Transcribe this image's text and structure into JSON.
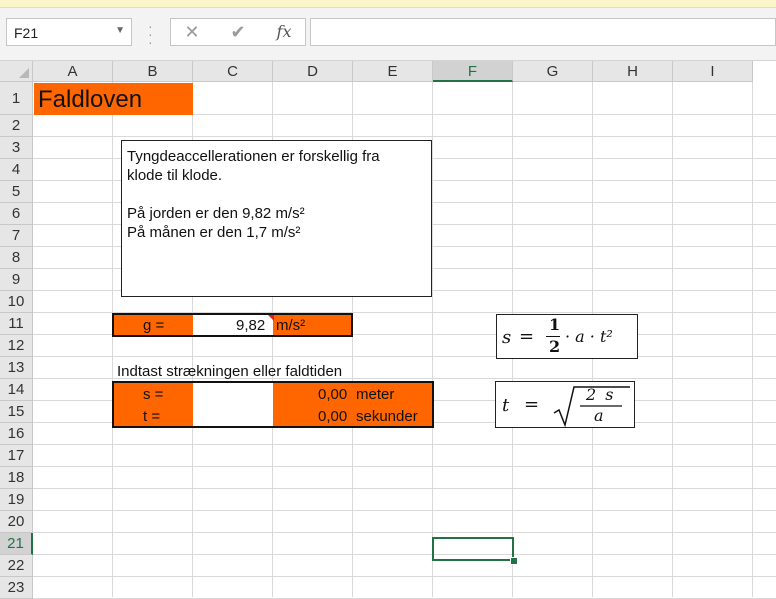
{
  "namebox": {
    "value": "F21"
  },
  "formula_bar": {
    "cancel_icon": "✕",
    "enter_icon": "✔",
    "fx_label": "fx",
    "value": ""
  },
  "columns": [
    "A",
    "B",
    "C",
    "D",
    "E",
    "F",
    "G",
    "H",
    "I"
  ],
  "selected_column": "F",
  "rows": [
    "1",
    "2",
    "3",
    "4",
    "5",
    "6",
    "7",
    "8",
    "9",
    "10",
    "11",
    "12",
    "13",
    "14",
    "15",
    "16",
    "17",
    "18",
    "19",
    "20",
    "21",
    "22",
    "23"
  ],
  "selected_row": "21",
  "sheet": {
    "title": "Faldloven",
    "textbox_lines": [
      "Tyngdeaccellerationen er forskellig fra",
      "klode til klode.",
      "",
      "På jorden er den 9,82 m/s²",
      "På månen er den 1,7 m/s²"
    ],
    "g_label": "g =",
    "g_value": "9,82",
    "g_unit": "m/s²",
    "prompt": "Indtast strækningen eller faldtiden",
    "s_label": "s =",
    "s_value": "0,00",
    "s_unit": "meter",
    "t_label": "t =",
    "t_value": "0,00",
    "t_unit": "sekunder"
  },
  "formulas": {
    "f1": {
      "lhs": "s",
      "num": "1",
      "den": "2",
      "rest": "· a · t²"
    },
    "f2": {
      "lhs": "t",
      "num": "2 s",
      "den": "a"
    }
  },
  "colors": {
    "orange": "#ff6600",
    "excel_green": "#217346"
  }
}
